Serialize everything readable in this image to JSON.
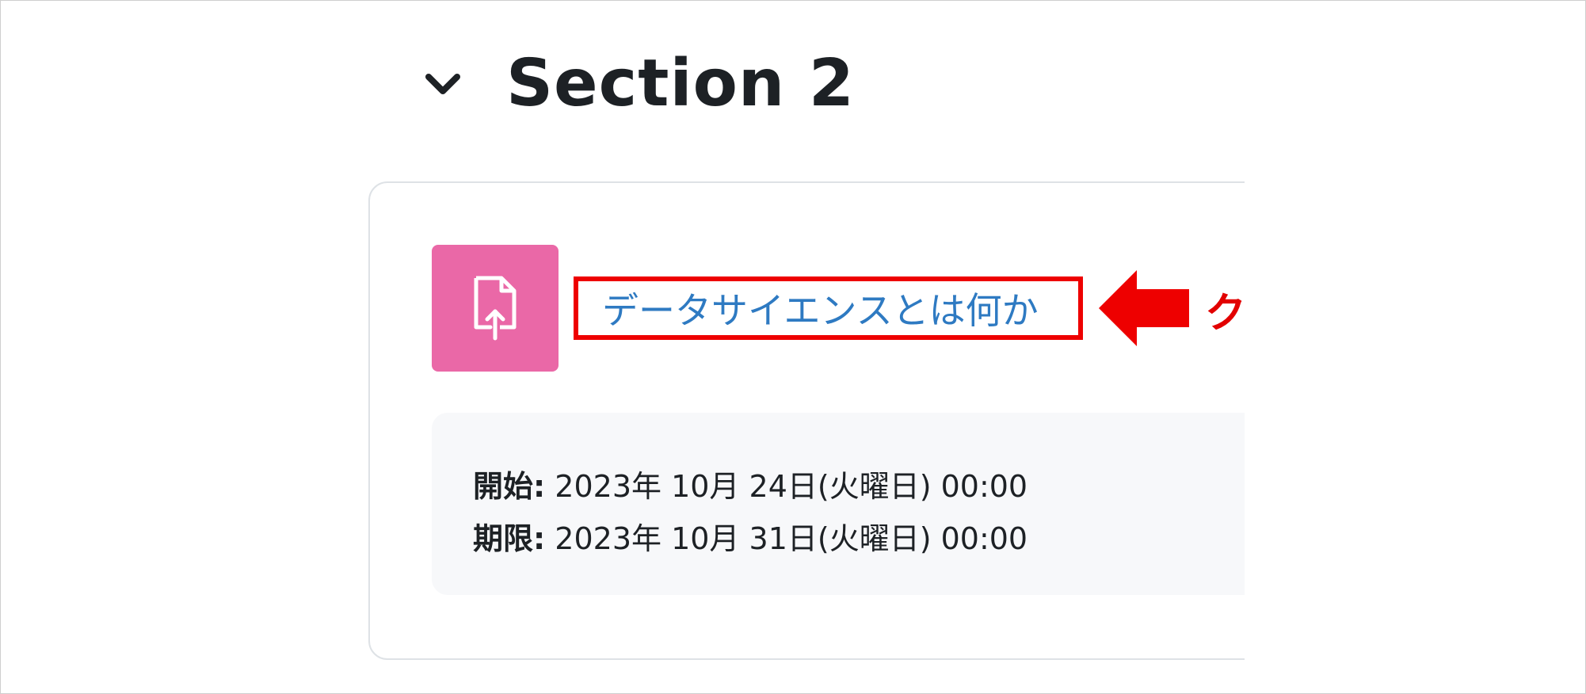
{
  "section": {
    "title": "Section 2"
  },
  "activity": {
    "icon": "file-upload-icon",
    "icon_color": "#ea68a7",
    "link_text": "データサイエンスとは何か",
    "link_color": "#2e7ac2"
  },
  "annotation": {
    "text": "クリック",
    "color": "#e20000"
  },
  "dates": {
    "start_label": "開始:",
    "start_value": "2023年 10月 24日(火曜日) 00:00",
    "due_label": "期限:",
    "due_value": "2023年 10月 31日(火曜日) 00:00"
  }
}
